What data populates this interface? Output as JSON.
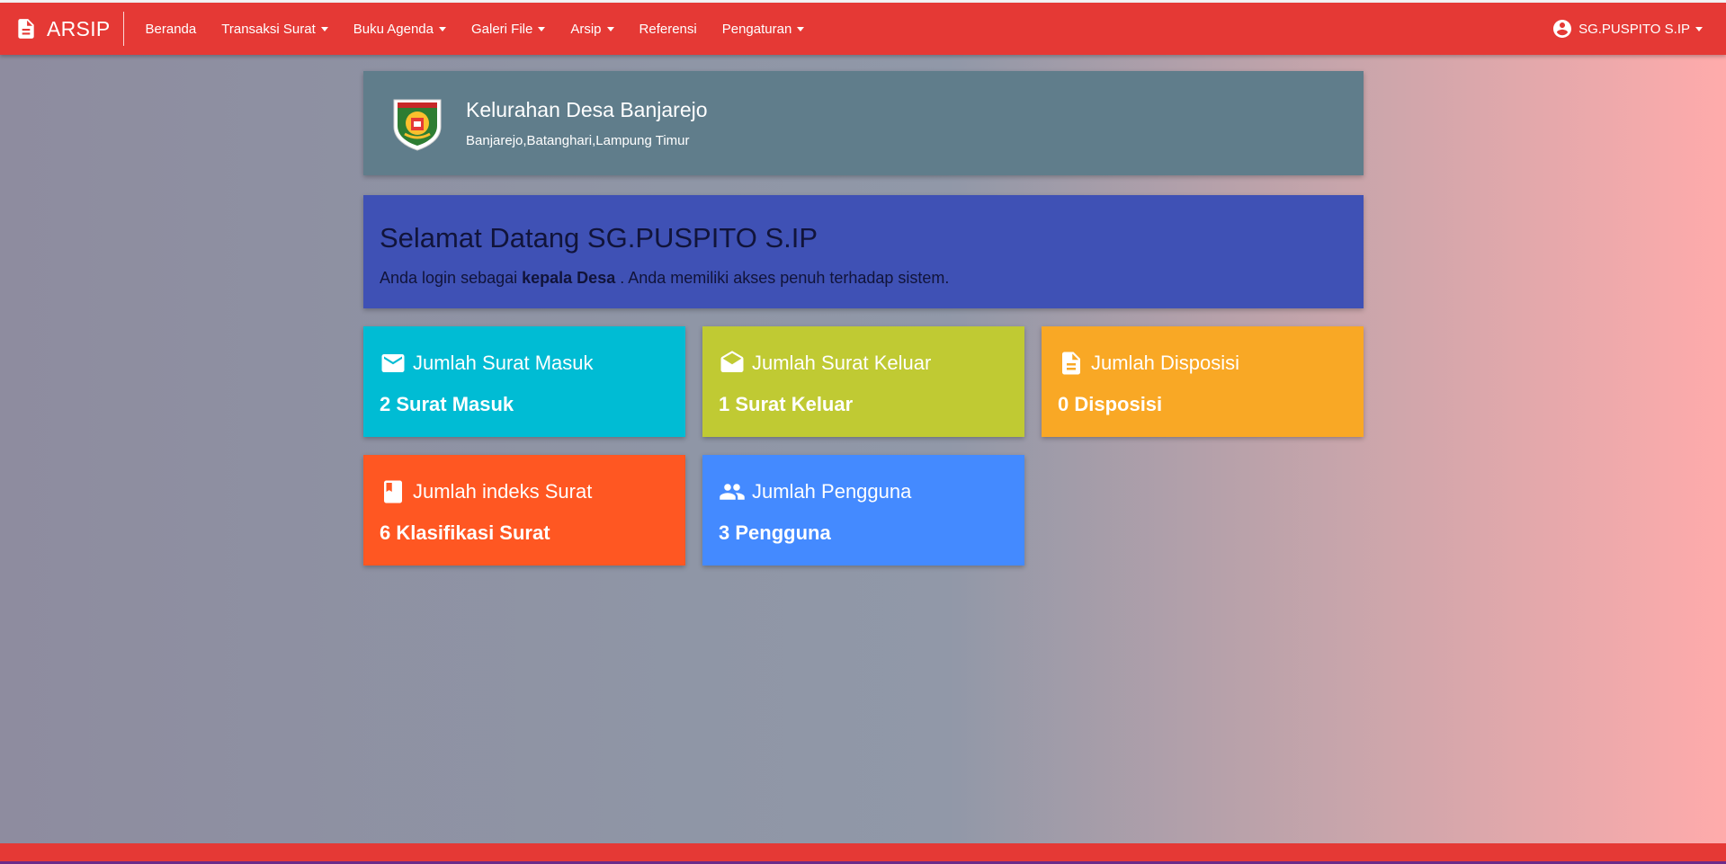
{
  "app": {
    "brand": "ARSIP",
    "brand_icon": "document-icon",
    "accent_color": "#e53935"
  },
  "nav": {
    "items": [
      {
        "label": "Beranda",
        "dropdown": false
      },
      {
        "label": "Transaksi Surat",
        "dropdown": true
      },
      {
        "label": "Buku Agenda",
        "dropdown": true
      },
      {
        "label": "Galeri File",
        "dropdown": true
      },
      {
        "label": "Arsip",
        "dropdown": true
      },
      {
        "label": "Referensi",
        "dropdown": false
      },
      {
        "label": "Pengaturan",
        "dropdown": true
      }
    ],
    "user": {
      "name": "SG.PUSPITO S.IP",
      "icon": "account-circle-icon"
    }
  },
  "header": {
    "title": "Kelurahan Desa Banjarejo",
    "subtitle": "Banjarejo,Batanghari,Lampung Timur",
    "logo": "village-emblem-logo",
    "color": "#607d8b"
  },
  "welcome": {
    "title": "Selamat Datang SG.PUSPITO S.IP",
    "text_before": "Anda login sebagai",
    "role": "kepala Desa",
    "text_after": ". Anda memiliki akses penuh terhadap sistem.",
    "color": "#3f51b5"
  },
  "stats": [
    {
      "title": "Jumlah Surat Masuk",
      "value": "2 Surat Masuk",
      "icon": "mail-icon",
      "color": "#00bcd4"
    },
    {
      "title": "Jumlah Surat Keluar",
      "value": "1 Surat Keluar",
      "icon": "drafts-icon",
      "color": "#c0ca33"
    },
    {
      "title": "Jumlah Disposisi",
      "value": "0 Disposisi",
      "icon": "description-icon",
      "color": "#f9a825"
    },
    {
      "title": "Jumlah indeks Surat",
      "value": "6 Klasifikasi Surat",
      "icon": "bookmark-icon",
      "color": "#ff5722"
    },
    {
      "title": "Jumlah Pengguna",
      "value": "3 Pengguna",
      "icon": "people-icon",
      "color": "#448aff"
    }
  ]
}
